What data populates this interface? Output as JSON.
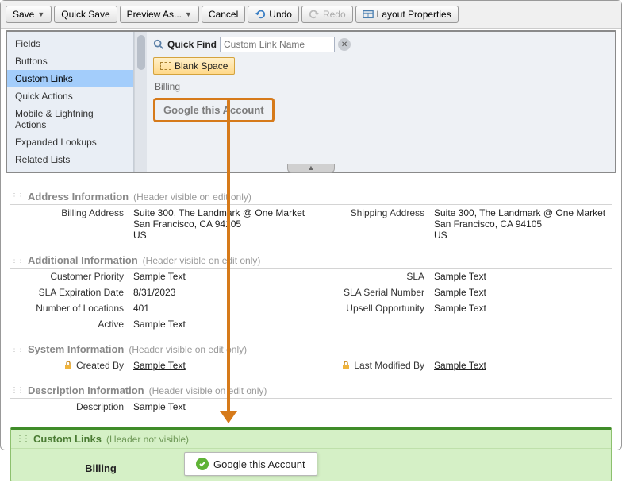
{
  "toolbar": {
    "save": "Save",
    "quick_save": "Quick Save",
    "preview_as": "Preview As...",
    "cancel": "Cancel",
    "undo": "Undo",
    "redo": "Redo",
    "layout_properties": "Layout Properties"
  },
  "palette": {
    "sidebar": [
      "Fields",
      "Buttons",
      "Custom Links",
      "Quick Actions",
      "Mobile & Lightning Actions",
      "Expanded Lookups",
      "Related Lists"
    ],
    "quick_find_label": "Quick Find",
    "quick_find_placeholder": "Custom Link Name",
    "blank_space": "Blank Space",
    "items": [
      "Billing",
      "Google this Account"
    ]
  },
  "sections": {
    "address": {
      "title": "Address Information",
      "note": "(Header visible on edit only)",
      "billing_label": "Billing Address",
      "billing_value": "Suite 300, The Landmark @ One Market\nSan Francisco, CA 94105\nUS",
      "shipping_label": "Shipping Address",
      "shipping_value": "Suite 300, The Landmark @ One Market\nSan Francisco, CA 94105\nUS"
    },
    "additional": {
      "title": "Additional Information",
      "note": "(Header visible on edit only)",
      "fields": [
        {
          "l": "Customer Priority",
          "v": "Sample Text",
          "r": "SLA",
          "rv": "Sample Text"
        },
        {
          "l": "SLA Expiration Date",
          "v": "8/31/2023",
          "r": "SLA Serial Number",
          "rv": "Sample Text"
        },
        {
          "l": "Number of Locations",
          "v": "401",
          "r": "Upsell Opportunity",
          "rv": "Sample Text"
        },
        {
          "l": "Active",
          "v": "Sample Text",
          "r": "",
          "rv": ""
        }
      ]
    },
    "system": {
      "title": "System Information",
      "note": "(Header visible on edit only)",
      "created_by_label": "Created By",
      "created_by_value": "Sample Text",
      "modified_by_label": "Last Modified By",
      "modified_by_value": "Sample Text"
    },
    "description": {
      "title": "Description Information",
      "note": "(Header visible on edit only)",
      "label": "Description",
      "value": "Sample Text"
    },
    "custom_links": {
      "title": "Custom Links",
      "note": "(Header not visible)",
      "billing": "Billing",
      "dropped": "Google this Account"
    }
  }
}
